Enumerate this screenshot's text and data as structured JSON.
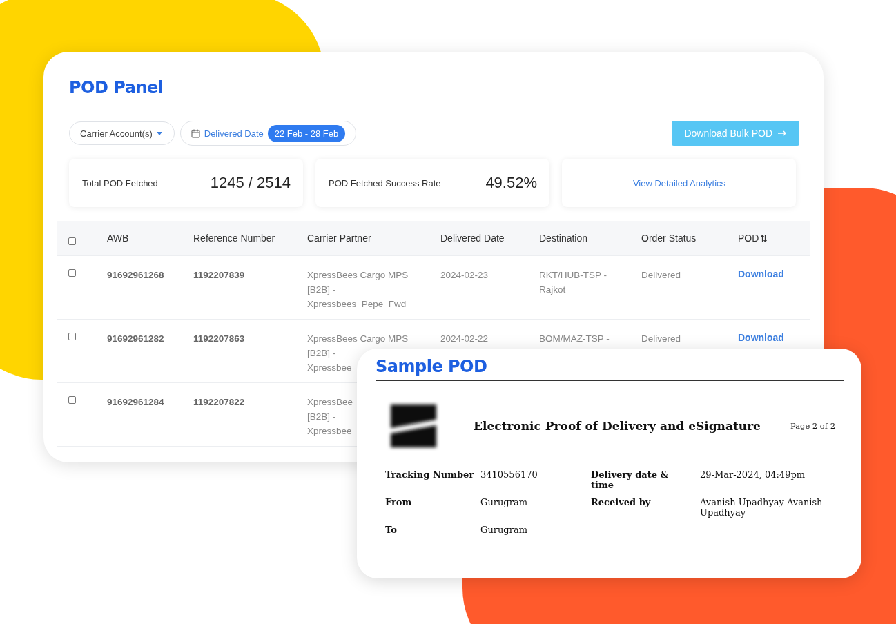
{
  "panel": {
    "title": "POD Panel",
    "filters": [
      {
        "kind": "dropdown",
        "label": "Carrier Account(s)"
      },
      {
        "kind": "date",
        "label": "Delivered Date",
        "value": "22 Feb - 28 Feb"
      }
    ],
    "action_button": "Download Bulk POD",
    "stats": [
      {
        "kind": "stat",
        "label": "Total POD Fetched",
        "value": "1245 / 2514"
      },
      {
        "kind": "stat",
        "label": "POD Fetched Success Rate",
        "value": "49.52%"
      },
      {
        "kind": "link",
        "label": "View Detailed Analytics"
      }
    ]
  },
  "table": {
    "header_checked": false,
    "columns": [
      "AWB",
      "Reference Number",
      "Carrier Partner",
      "Delivered Date",
      "Destination",
      "Order Status",
      "POD"
    ],
    "rows": [
      {
        "checked": false,
        "awb": "91692961268",
        "reference": "1192207839",
        "carrier": [
          "XpressBees Cargo MPS",
          "[B2B] -",
          "Xpressbees_Pepe_Fwd"
        ],
        "delivered_date": "2024-02-23",
        "destination": [
          "RKT/HUB-TSP -",
          "Rajkot"
        ],
        "order_status": "Delivered",
        "pod": "Download"
      },
      {
        "checked": false,
        "awb": "91692961282",
        "reference": "1192207863",
        "carrier": [
          "XpressBees Cargo MPS",
          "[B2B] -",
          "Xpressbee"
        ],
        "delivered_date": "2024-02-22",
        "destination": [
          "BOM/MAZ-TSP -"
        ],
        "order_status": "Delivered",
        "pod": "Download"
      },
      {
        "checked": false,
        "awb": "91692961284",
        "reference": "1192207822",
        "carrier": [
          "XpressBee",
          "[B2B] -",
          "Xpressbee"
        ]
      }
    ]
  },
  "sample_pod": {
    "title": "Sample POD",
    "document": {
      "heading": "Electronic Proof of Delivery and eSignature",
      "page": "Page 2 of 2",
      "fields": [
        {
          "label": "Tracking Number",
          "value": "3410556170"
        },
        {
          "label": "Delivery date & time",
          "value": "29-Mar-2024, 04:49pm"
        },
        {
          "label": "From",
          "value": "Gurugram"
        },
        {
          "label": "Received by",
          "value": "Avanish Upadhyay Avanish Upadhyay"
        },
        {
          "label": "To",
          "value": "Gurugram"
        }
      ]
    }
  }
}
